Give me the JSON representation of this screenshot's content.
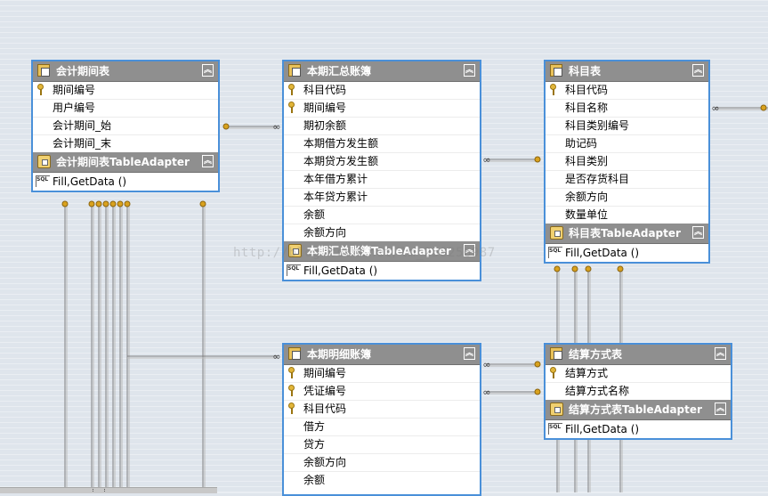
{
  "tables": {
    "period": {
      "title": "会计期间表",
      "adapter": "会计期间表TableAdapter",
      "query": "Fill,GetData ()",
      "fields": [
        {
          "name": "期间编号",
          "key": true
        },
        {
          "name": "用户编号",
          "key": false
        },
        {
          "name": "会计期间_始",
          "key": false
        },
        {
          "name": "会计期间_末",
          "key": false
        }
      ]
    },
    "summary": {
      "title": "本期汇总账簿",
      "adapter": "本期汇总账簿TableAdapter",
      "query": "Fill,GetData ()",
      "fields": [
        {
          "name": "科目代码",
          "key": true
        },
        {
          "name": "期间编号",
          "key": true
        },
        {
          "name": "期初余额",
          "key": false
        },
        {
          "name": "本期借方发生额",
          "key": false
        },
        {
          "name": "本期贷方发生额",
          "key": false
        },
        {
          "name": "本年借方累计",
          "key": false
        },
        {
          "name": "本年贷方累计",
          "key": false
        },
        {
          "name": "余额",
          "key": false
        },
        {
          "name": "余额方向",
          "key": false
        }
      ]
    },
    "subject": {
      "title": "科目表",
      "adapter": "科目表TableAdapter",
      "query": "Fill,GetData ()",
      "fields": [
        {
          "name": "科目代码",
          "key": true
        },
        {
          "name": "科目名称",
          "key": false
        },
        {
          "name": "科目类别编号",
          "key": false
        },
        {
          "name": "助记码",
          "key": false
        },
        {
          "name": "科目类别",
          "key": false
        },
        {
          "name": "是否存货科目",
          "key": false
        },
        {
          "name": "余额方向",
          "key": false
        },
        {
          "name": "数量单位",
          "key": false
        }
      ]
    },
    "detail": {
      "title": "本期明细账簿",
      "fields": [
        {
          "name": "期间编号",
          "key": true
        },
        {
          "name": "凭证编号",
          "key": true
        },
        {
          "name": "科目代码",
          "key": true
        },
        {
          "name": "借方",
          "key": false
        },
        {
          "name": "贷方",
          "key": false
        },
        {
          "name": "余额方向",
          "key": false
        },
        {
          "name": "余额",
          "key": false
        }
      ]
    },
    "settlement": {
      "title": "结算方式表",
      "adapter": "结算方式表TableAdapter",
      "query": "Fill,GetData ()",
      "fields": [
        {
          "name": "结算方式",
          "key": true
        },
        {
          "name": "结算方式名称",
          "key": false
        }
      ]
    }
  },
  "watermark": "http://blog.csdn.net/lm_258256987",
  "icons": {
    "table": "table-icon",
    "key": "primary-key-icon",
    "adapter": "table-adapter-icon",
    "query": "sql-query-icon",
    "collapse": "collapse-chevron-icon"
  },
  "colors": {
    "border": "#4a90d9",
    "header": "#8f8f8f",
    "canvas": "#dfe5ec",
    "wire": "#7f7f7f",
    "endpoint": "#d9a21e"
  }
}
